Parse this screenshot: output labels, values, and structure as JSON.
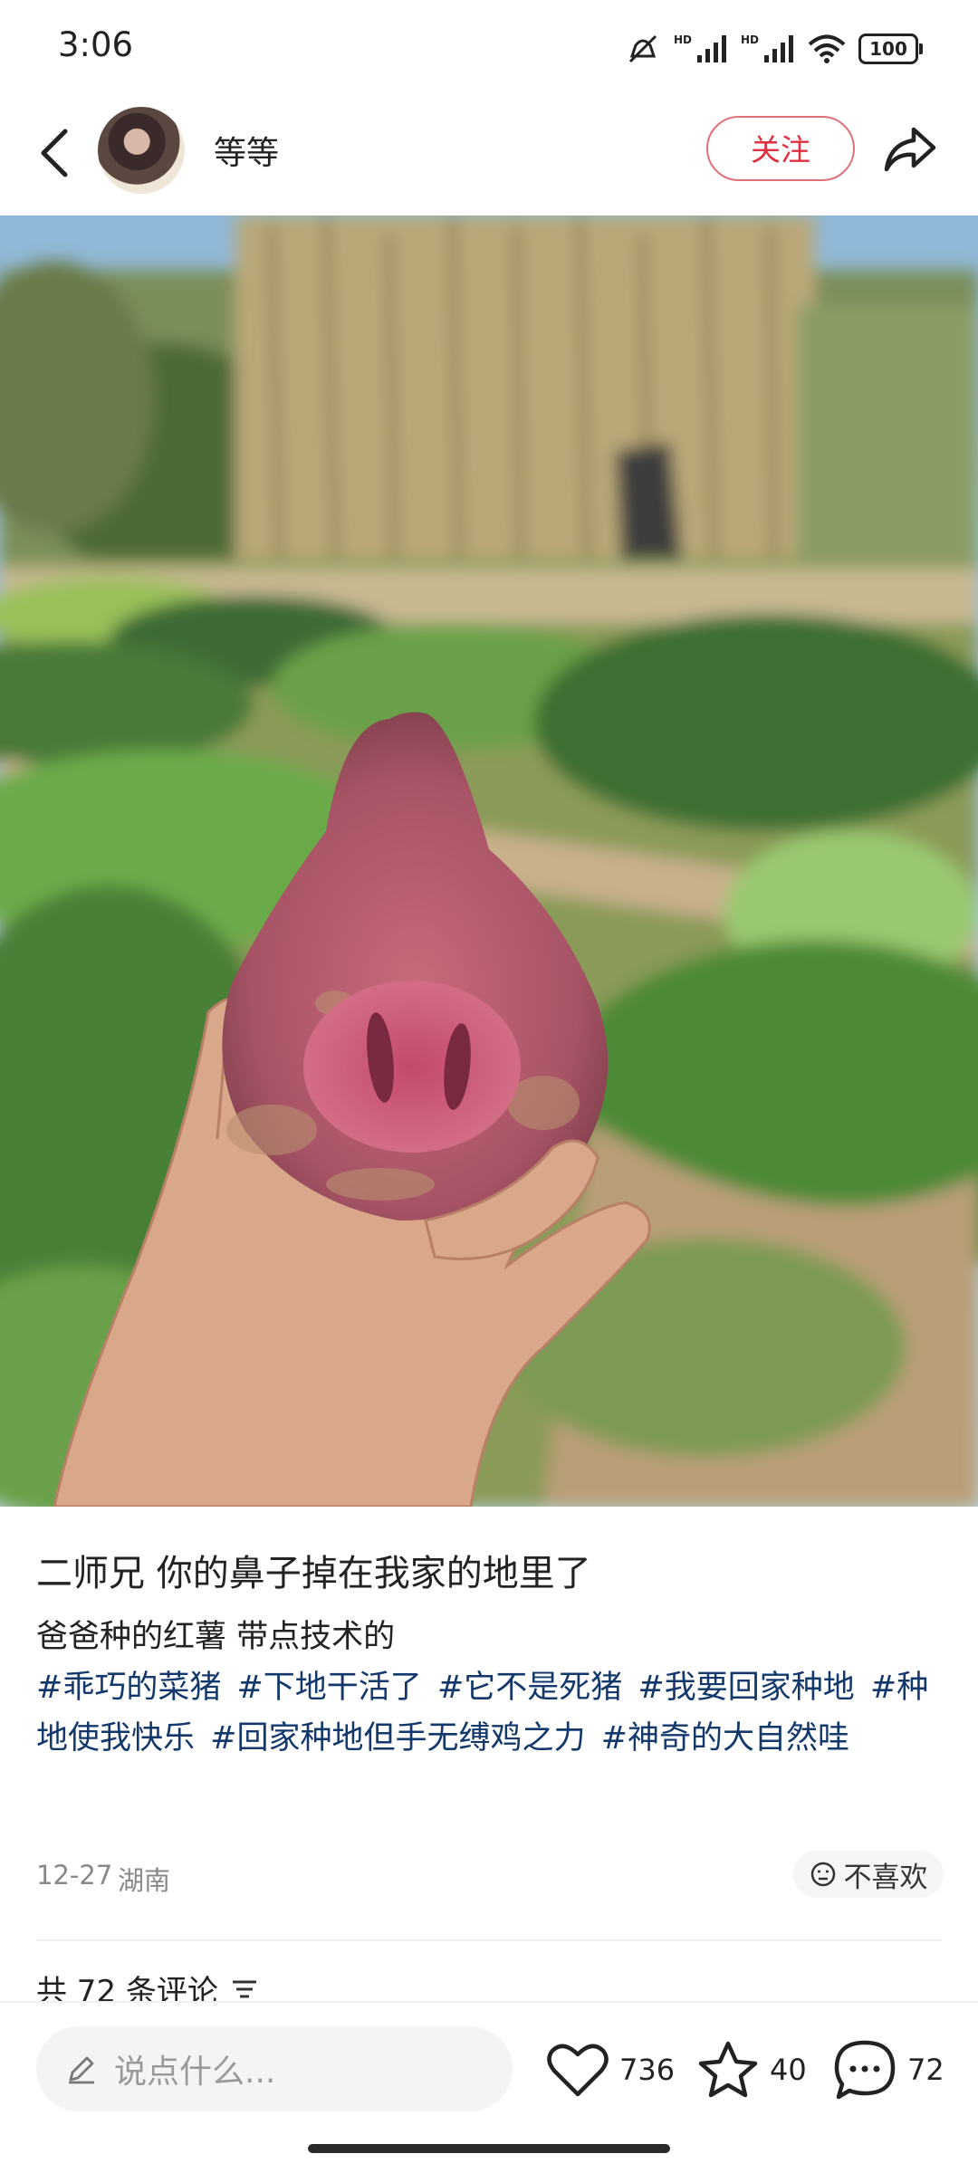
{
  "status": {
    "time": "3:06",
    "battery": "100",
    "hd1": "HD",
    "hd2": "HD"
  },
  "header": {
    "author_name": "等等",
    "follow_label": "关注"
  },
  "post": {
    "title": "二师兄 你的鼻子掉在我家的地里了",
    "description": "爸爸种的红薯 带点技术的",
    "tags": [
      "#乖巧的菜猪",
      "#下地干活了",
      "#它不是死猪",
      "#我要回家种地",
      "#种地使我快乐",
      "#回家种地但手无缚鸡之力",
      "#神奇的大自然哇"
    ],
    "date": "12-27",
    "location": "湖南",
    "dislike_label": "不喜欢"
  },
  "comments": {
    "count_label": "共 72 条评论"
  },
  "bottom": {
    "input_placeholder": "说点什么...",
    "likes": "736",
    "favorites": "40",
    "comments": "72"
  },
  "colors": {
    "follow": "#e03040",
    "tag": "#13386c"
  },
  "icons": [
    "back-arrow-icon",
    "share-icon",
    "pen-icon",
    "heart-icon",
    "star-icon",
    "comment-bubble-icon",
    "dislike-face-icon",
    "sort-icon"
  ]
}
